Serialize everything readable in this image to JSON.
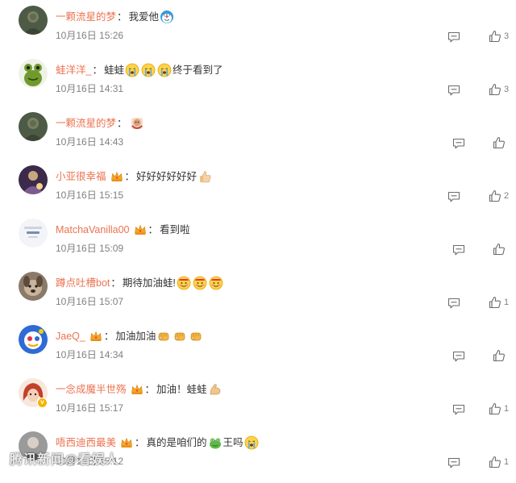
{
  "colors": {
    "username": "#eb7350",
    "text": "#333333",
    "meta": "#808080"
  },
  "separator": "：",
  "comments": [
    {
      "username": "一颗流星的梦",
      "crown": false,
      "verified": false,
      "avatar": "avatar-dark-green",
      "text": "我爱他",
      "emojis_after": [
        "doraemon-face-emoji"
      ],
      "time": "10月16日 15:26",
      "likes": "3"
    },
    {
      "username": "蛙洋洋_",
      "crown": false,
      "verified": false,
      "avatar": "avatar-frog",
      "text": "蛙蛙",
      "emojis_after": [
        "crying-face-emoji",
        "crying-face-emoji",
        "crying-face-emoji"
      ],
      "text_after": "终于看到了",
      "time": "10月16日 14:31",
      "likes": "3"
    },
    {
      "username": "一颗流星的梦",
      "crown": false,
      "verified": false,
      "avatar": "avatar-dark-green",
      "text": "",
      "emojis_after": [
        "hug-sticker-emoji"
      ],
      "time": "10月16日 14:43",
      "likes": ""
    },
    {
      "username": "小亚很幸福",
      "crown": true,
      "verified": false,
      "avatar": "avatar-purple",
      "text": "好好好好好好",
      "emojis_after": [
        "thumbs-up-emoji"
      ],
      "time": "10月16日 15:15",
      "likes": "2"
    },
    {
      "username": "MatchaVanilla00",
      "crown": true,
      "verified": false,
      "avatar": "avatar-light-card",
      "text": "看到啦",
      "emojis_after": [],
      "time": "10月16日 15:09",
      "likes": ""
    },
    {
      "username": "蹲点吐槽bot",
      "crown": false,
      "verified": false,
      "avatar": "avatar-brown-dog",
      "text": "期待加油蛙!",
      "emojis_after": [
        "cheer-face-emoji",
        "cheer-face-emoji",
        "cheer-face-emoji"
      ],
      "time": "10月16日 15:07",
      "likes": "1"
    },
    {
      "username": "JaeQ_",
      "crown": true,
      "verified": false,
      "avatar": "avatar-blue-cartoon",
      "text": "加油加油",
      "emojis_after": [
        "fist-emoji",
        "fist-emoji",
        "fist-emoji"
      ],
      "time": "10月16日 14:34",
      "likes": ""
    },
    {
      "username": "一念成魔半世殇",
      "crown": true,
      "verified": true,
      "avatar": "avatar-red-hair",
      "text": "加油！蛙蛙",
      "emojis_after": [
        "muscle-emoji"
      ],
      "time": "10月16日 15:17",
      "likes": "1"
    },
    {
      "username": "唔西迪西最美",
      "crown": true,
      "verified": false,
      "avatar": "avatar-grey-photo",
      "text": "真的是咱们的",
      "emojis_after": [
        "frog-emoji"
      ],
      "text_after": "王吗",
      "emojis_end": [
        "crying-face-emoji"
      ],
      "time": "10月16日 15:12",
      "likes": "1"
    }
  ],
  "watermark": "腾讯新闻@看娱人"
}
